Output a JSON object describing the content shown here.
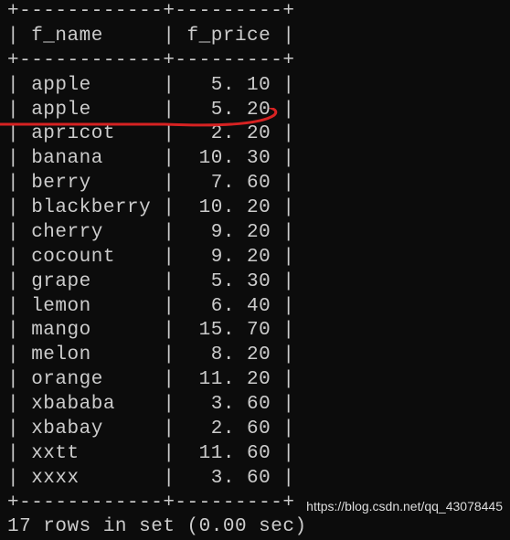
{
  "columns": [
    "f_name",
    "f_price"
  ],
  "rows": [
    {
      "f_name": "apple",
      "f_price": "5.10"
    },
    {
      "f_name": "apple",
      "f_price": "5.20"
    },
    {
      "f_name": "apricot",
      "f_price": "2.20"
    },
    {
      "f_name": "banana",
      "f_price": "10.30"
    },
    {
      "f_name": "berry",
      "f_price": "7.60"
    },
    {
      "f_name": "blackberry",
      "f_price": "10.20"
    },
    {
      "f_name": "cherry",
      "f_price": "9.20"
    },
    {
      "f_name": "cocount",
      "f_price": "9.20"
    },
    {
      "f_name": "grape",
      "f_price": "5.30"
    },
    {
      "f_name": "lemon",
      "f_price": "6.40"
    },
    {
      "f_name": "mango",
      "f_price": "15.70"
    },
    {
      "f_name": "melon",
      "f_price": "8.20"
    },
    {
      "f_name": "orange",
      "f_price": "11.20"
    },
    {
      "f_name": "xbababa",
      "f_price": "3.60"
    },
    {
      "f_name": "xbabay",
      "f_price": "2.60"
    },
    {
      "f_name": "xxtt",
      "f_price": "11.60"
    },
    {
      "f_name": "xxxx",
      "f_price": "3.60"
    }
  ],
  "status": "17 rows in set (0.00 sec)",
  "watermark": "https://blog.csdn.net/qq_43078445",
  "border": {
    "top": "+------------+---------+",
    "mid": "+------------+---------+",
    "bot": "+------------+---------+"
  }
}
